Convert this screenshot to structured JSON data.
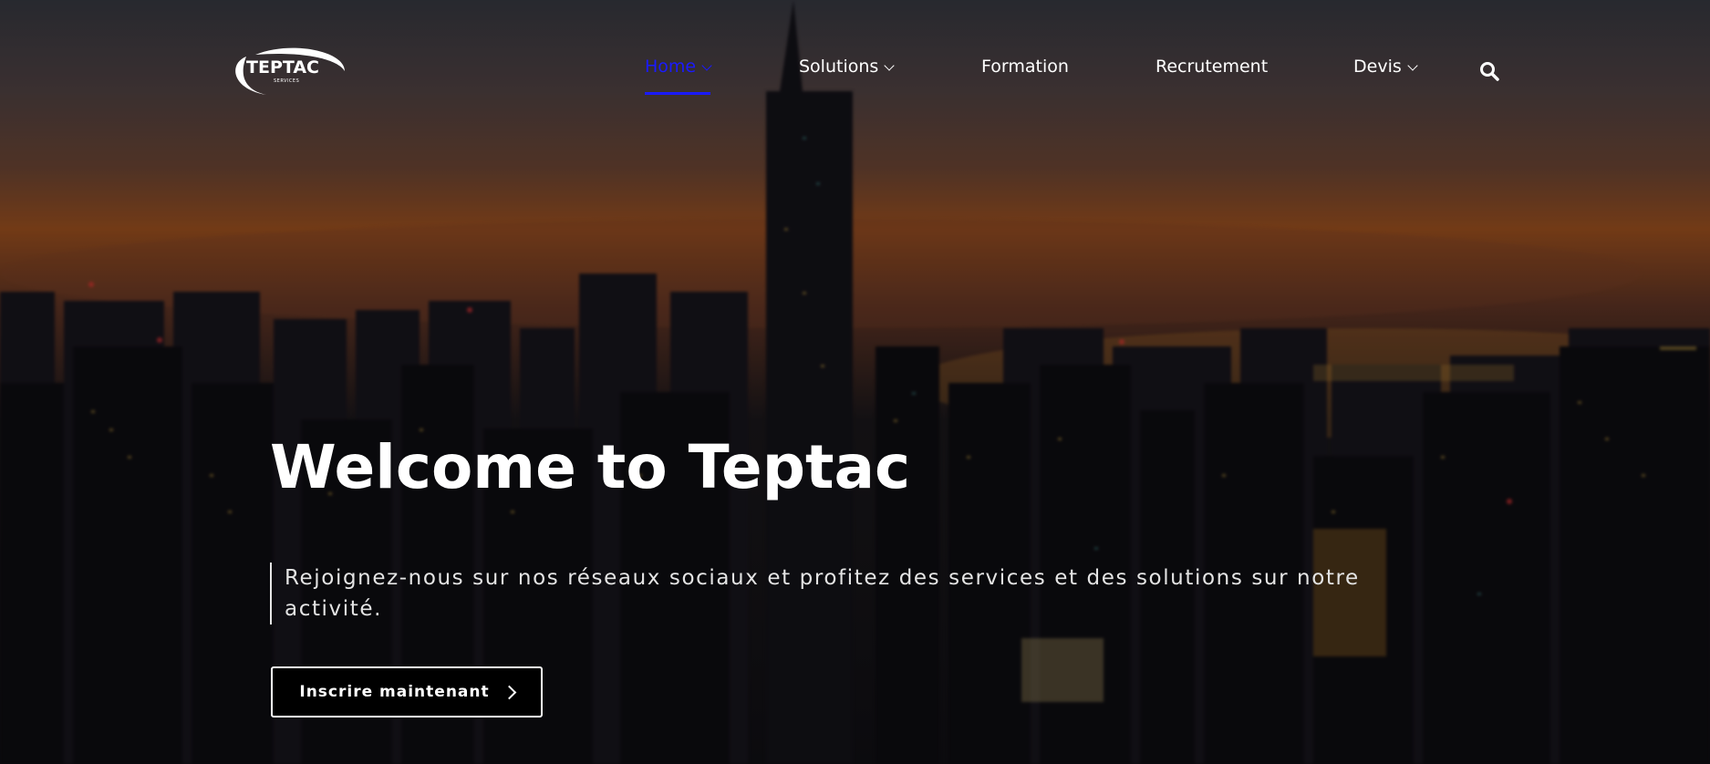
{
  "brand": {
    "logo_text": "TEPTAC",
    "logo_subtext": "SERVICES"
  },
  "nav": {
    "items": [
      {
        "label": "Home",
        "active": true,
        "has_dropdown": true
      },
      {
        "label": "Solutions",
        "active": false,
        "has_dropdown": true
      },
      {
        "label": "Formation",
        "active": false,
        "has_dropdown": false
      },
      {
        "label": "Recrutement",
        "active": false,
        "has_dropdown": false
      },
      {
        "label": "Devis",
        "active": false,
        "has_dropdown": true
      }
    ],
    "search_icon": "search-icon",
    "active_color": "#1a1aff"
  },
  "hero": {
    "title": "Welcome to Teptac",
    "tagline": "Rejoignez-nous sur nos réseaux sociaux et profitez des services et des solutions sur notre activité.",
    "cta_label": "Inscrire maintenant",
    "cta_icon": "chevron-right-icon"
  }
}
